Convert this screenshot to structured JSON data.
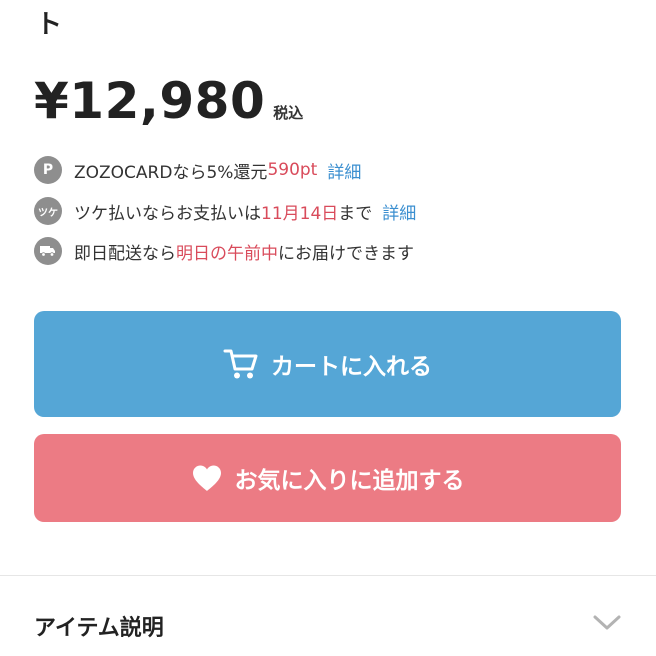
{
  "product": {
    "title_tail": "ト",
    "price": "¥12,980",
    "tax_label": "税込"
  },
  "info": {
    "points": {
      "icon": "points-icon",
      "icon_text": "P",
      "text": "ZOZOCARDなら5%還元",
      "highlight": "590pt",
      "link": "詳細"
    },
    "tsuke": {
      "icon": "tsuke-payment-icon",
      "icon_text": "ツケ",
      "text_before": "ツケ払いならお支払いは",
      "highlight": "11月14日",
      "text_after": "まで",
      "link": "詳細"
    },
    "delivery": {
      "icon": "truck-icon",
      "text_before": "即日配送なら",
      "highlight": "明日の午前中",
      "text_after": "にお届けできます"
    }
  },
  "buttons": {
    "cart_label": "カートに入れる",
    "favorite_label": "お気に入りに追加する"
  },
  "section": {
    "item_description": "アイテム説明"
  },
  "colors": {
    "cart_button": "#55a6d6",
    "favorite_button": "#ec7b84",
    "highlight": "#d94b5b",
    "link": "#3b8fd0"
  }
}
